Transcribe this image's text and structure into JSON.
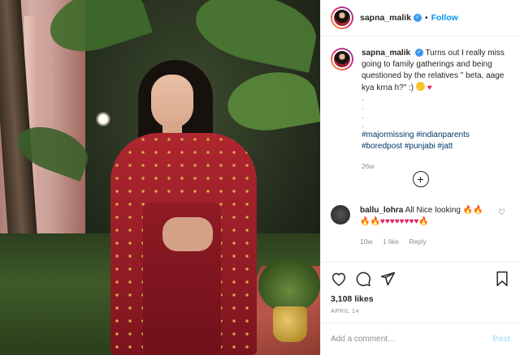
{
  "header": {
    "username": "sapna_malik",
    "follow_label": "Follow",
    "separator": "•"
  },
  "caption": {
    "username": "sapna_malik",
    "text": "Turns out I really miss going to family gatherings and being questioned by the relatives \" beta, aage kya krna h?\" :)",
    "dots": [
      ".",
      ".",
      ".",
      "."
    ],
    "hashtags": [
      "#majormissing",
      "#indianparents",
      "#boredpost",
      "#punjabi",
      "#jatt"
    ],
    "age": "26w"
  },
  "comment": {
    "username": "ballu_lohra",
    "text": "All Nice looking",
    "age": "10w",
    "likes": "1 like",
    "reply_label": "Reply"
  },
  "likes_text": "3,108 likes",
  "date": "APRIL 14",
  "add_comment": {
    "placeholder": "Add a comment…",
    "post_label": "Post"
  },
  "icons": {
    "heart": "heart-icon",
    "comment": "comment-icon",
    "share": "share-icon",
    "bookmark": "bookmark-icon",
    "load_more": "plus-circle-icon",
    "verified": "verified-badge-icon"
  },
  "colors": {
    "link": "#0095f6",
    "hashtag": "#00376b",
    "muted": "#8e8e8e"
  }
}
